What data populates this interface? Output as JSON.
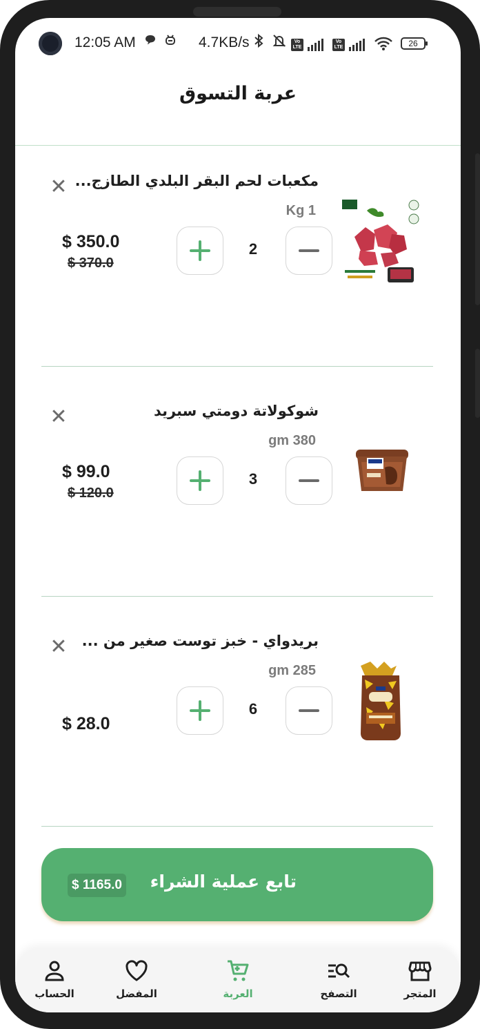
{
  "status_bar": {
    "time": "12:05 AM",
    "speed": "4.7KB/s",
    "battery": "26",
    "lte1": "Vo LTE",
    "lte2": "Vo LTE"
  },
  "header": {
    "title": "عربة التسوق"
  },
  "cart": {
    "items": [
      {
        "name": "مكعبات لحم البقر البلدي الطازج...",
        "size": "Kg 1",
        "quantity": "2",
        "price": "$ 350.0",
        "old_price": "$ 370.0",
        "image": "beef-cubes-image"
      },
      {
        "name": "شوكولاتة دومتي سبريد",
        "size": "gm 380",
        "quantity": "3",
        "price": "$ 99.0",
        "old_price": "$ 120.0",
        "image": "chocolate-spread-image"
      },
      {
        "name": "بريدواي - خبز توست صغير من ...",
        "size": "gm 285",
        "quantity": "6",
        "price": "$ 28.0",
        "old_price": "",
        "image": "toast-bread-image"
      }
    ]
  },
  "checkout": {
    "label": "تابع عملية الشراء",
    "total": "$ 1165.0"
  },
  "nav": {
    "items": [
      {
        "label": "الحساب",
        "icon": "person-icon"
      },
      {
        "label": "المفضل",
        "icon": "heart-icon"
      },
      {
        "label": "العربة",
        "icon": "cart-icon",
        "active": true
      },
      {
        "label": "التصفح",
        "icon": "browse-search-icon"
      },
      {
        "label": "المتجر",
        "icon": "store-icon"
      }
    ]
  },
  "colors": {
    "accent": "#55b071",
    "divider": "#b7d4c1",
    "text": "#1f1f1f"
  }
}
